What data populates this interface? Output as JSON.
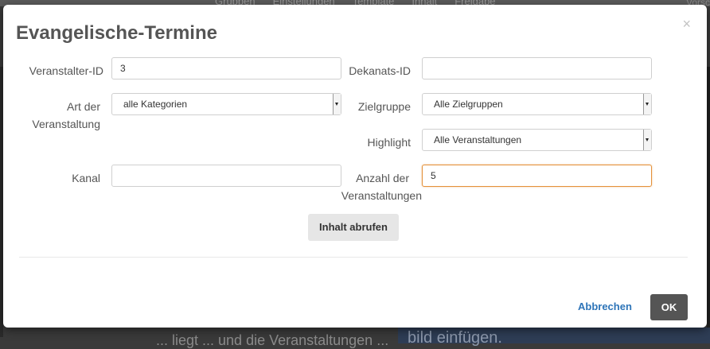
{
  "background": {
    "nav_items": [
      "Gruppen",
      "Einstellungen",
      "Template",
      "Inhalt",
      "Freigabe"
    ],
    "right_text": "Vorsc",
    "bottom_text": "... liegt ... und die Veranstaltungen ...",
    "bottom_panel_text": "bild einfügen."
  },
  "modal": {
    "title": "Evangelische-Termine",
    "close_symbol": "×",
    "fields": {
      "veranstalter_id": {
        "label": "Veranstalter-ID",
        "value": "3"
      },
      "dekanats_id": {
        "label": "Dekanats-ID",
        "value": ""
      },
      "art_der_veranstaltung": {
        "label_line1": "Art der",
        "label_line2": "Veranstaltung",
        "selected": "alle Kategorien"
      },
      "zielgruppe": {
        "label": "Zielgruppe",
        "selected": "Alle Zielgruppen"
      },
      "highlight": {
        "label": "Highlight",
        "selected": "Alle Veranstaltungen"
      },
      "kanal": {
        "label": "Kanal",
        "value": ""
      },
      "anzahl": {
        "label_line1": "Anzahl der",
        "label_line2": "Veranstaltungen",
        "value": "5"
      }
    },
    "fetch_button": "Inhalt abrufen",
    "cancel_button": "Abbrechen",
    "ok_button": "OK"
  },
  "colors": {
    "accent_link": "#2d74b8",
    "focus_border": "#e4913a",
    "ok_button_bg": "#555555"
  }
}
